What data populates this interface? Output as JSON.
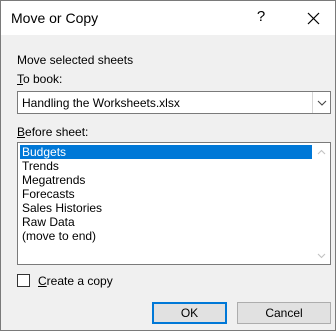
{
  "window": {
    "title": "Move or Copy",
    "help_label": "?"
  },
  "form": {
    "move_label": "Move selected sheets",
    "to_book_prefix": "T",
    "to_book_rest": "o book:",
    "to_book_value": "Handling the Worksheets.xlsx",
    "before_prefix": "B",
    "before_rest": "efore sheet:",
    "sheets": [
      "Budgets",
      "Trends",
      "Megatrends",
      "Forecasts",
      "Sales Histories",
      "Raw Data",
      "(move to end)"
    ],
    "selected_sheet": "Budgets",
    "copy_prefix": "C",
    "copy_rest": "reate a copy",
    "copy_checked": false
  },
  "buttons": {
    "ok": "OK",
    "cancel": "Cancel"
  },
  "colors": {
    "selection": "#0078d7",
    "default_button_border": "#0078d7"
  }
}
